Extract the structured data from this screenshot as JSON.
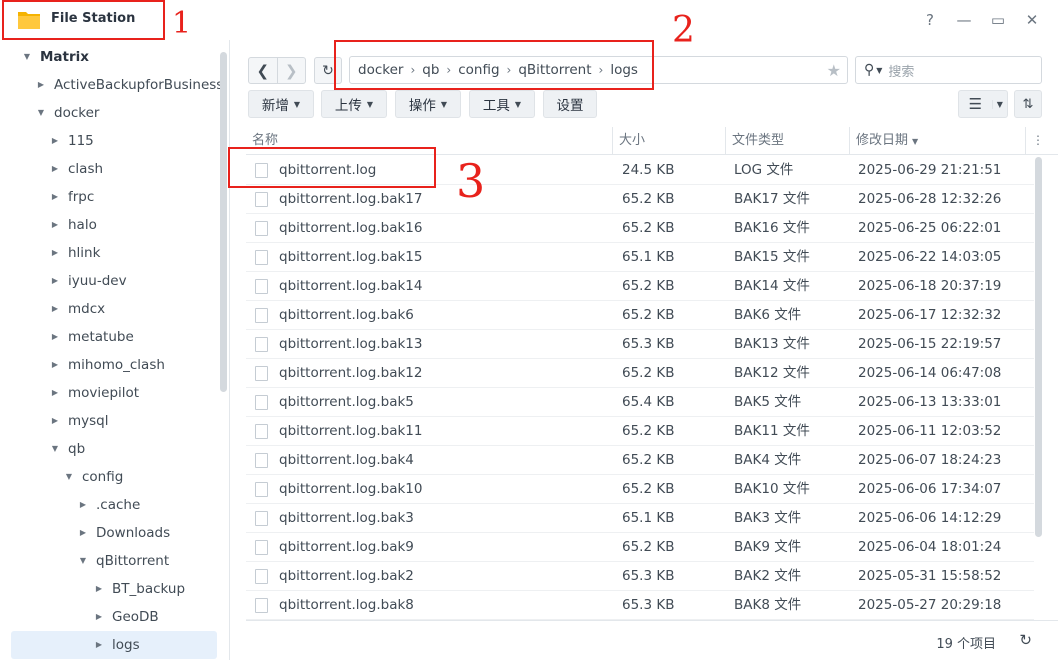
{
  "window": {
    "title": "File Station",
    "controls": {
      "help": "?",
      "minimize": "—",
      "maximize": "▭",
      "close": "✕"
    }
  },
  "sidebar": {
    "items": [
      {
        "label": "Matrix",
        "level": 0,
        "state": "expanded"
      },
      {
        "label": "ActiveBackupforBusiness",
        "level": 1,
        "state": "collapsed"
      },
      {
        "label": "docker",
        "level": 1,
        "state": "expanded"
      },
      {
        "label": "115",
        "level": 2,
        "state": "collapsed"
      },
      {
        "label": "clash",
        "level": 2,
        "state": "collapsed"
      },
      {
        "label": "frpc",
        "level": 2,
        "state": "collapsed"
      },
      {
        "label": "halo",
        "level": 2,
        "state": "collapsed"
      },
      {
        "label": "hlink",
        "level": 2,
        "state": "collapsed"
      },
      {
        "label": "iyuu-dev",
        "level": 2,
        "state": "collapsed"
      },
      {
        "label": "mdcx",
        "level": 2,
        "state": "collapsed"
      },
      {
        "label": "metatube",
        "level": 2,
        "state": "collapsed"
      },
      {
        "label": "mihomo_clash",
        "level": 2,
        "state": "collapsed"
      },
      {
        "label": "moviepilot",
        "level": 2,
        "state": "collapsed"
      },
      {
        "label": "mysql",
        "level": 2,
        "state": "collapsed"
      },
      {
        "label": "qb",
        "level": 2,
        "state": "expanded"
      },
      {
        "label": "config",
        "level": 3,
        "state": "expanded"
      },
      {
        "label": ".cache",
        "level": 4,
        "state": "collapsed"
      },
      {
        "label": "Downloads",
        "level": 4,
        "state": "collapsed"
      },
      {
        "label": "qBittorrent",
        "level": 4,
        "state": "expanded"
      },
      {
        "label": "BT_backup",
        "level": 5,
        "state": "collapsed"
      },
      {
        "label": "GeoDB",
        "level": 5,
        "state": "collapsed"
      },
      {
        "label": "logs",
        "level": 5,
        "state": "collapsed",
        "selected": true
      }
    ]
  },
  "toolbar": {
    "back_icon": "chevron-left-icon",
    "forward_icon": "chevron-right-icon",
    "refresh_icon": "refresh-icon",
    "breadcrumb": [
      "docker",
      "qb",
      "config",
      "qBittorrent",
      "logs"
    ],
    "search_placeholder": "搜索",
    "buttons": {
      "create": "新增",
      "upload": "上传",
      "action": "操作",
      "tools": "工具",
      "settings": "设置"
    }
  },
  "file_list": {
    "columns": {
      "name": "名称",
      "size": "大小",
      "type": "文件类型",
      "modified": "修改日期"
    },
    "rows": [
      {
        "name": "qbittorrent.log",
        "size": "24.5 KB",
        "type": "LOG 文件",
        "modified": "2025-06-29 21:21:51"
      },
      {
        "name": "qbittorrent.log.bak17",
        "size": "65.2 KB",
        "type": "BAK17 文件",
        "modified": "2025-06-28 12:32:26"
      },
      {
        "name": "qbittorrent.log.bak16",
        "size": "65.2 KB",
        "type": "BAK16 文件",
        "modified": "2025-06-25 06:22:01"
      },
      {
        "name": "qbittorrent.log.bak15",
        "size": "65.1 KB",
        "type": "BAK15 文件",
        "modified": "2025-06-22 14:03:05"
      },
      {
        "name": "qbittorrent.log.bak14",
        "size": "65.2 KB",
        "type": "BAK14 文件",
        "modified": "2025-06-18 20:37:19"
      },
      {
        "name": "qbittorrent.log.bak6",
        "size": "65.2 KB",
        "type": "BAK6 文件",
        "modified": "2025-06-17 12:32:32"
      },
      {
        "name": "qbittorrent.log.bak13",
        "size": "65.3 KB",
        "type": "BAK13 文件",
        "modified": "2025-06-15 22:19:57"
      },
      {
        "name": "qbittorrent.log.bak12",
        "size": "65.2 KB",
        "type": "BAK12 文件",
        "modified": "2025-06-14 06:47:08"
      },
      {
        "name": "qbittorrent.log.bak5",
        "size": "65.4 KB",
        "type": "BAK5 文件",
        "modified": "2025-06-13 13:33:01"
      },
      {
        "name": "qbittorrent.log.bak11",
        "size": "65.2 KB",
        "type": "BAK11 文件",
        "modified": "2025-06-11 12:03:52"
      },
      {
        "name": "qbittorrent.log.bak4",
        "size": "65.2 KB",
        "type": "BAK4 文件",
        "modified": "2025-06-07 18:24:23"
      },
      {
        "name": "qbittorrent.log.bak10",
        "size": "65.2 KB",
        "type": "BAK10 文件",
        "modified": "2025-06-06 17:34:07"
      },
      {
        "name": "qbittorrent.log.bak3",
        "size": "65.1 KB",
        "type": "BAK3 文件",
        "modified": "2025-06-06 14:12:29"
      },
      {
        "name": "qbittorrent.log.bak9",
        "size": "65.2 KB",
        "type": "BAK9 文件",
        "modified": "2025-06-04 18:01:24"
      },
      {
        "name": "qbittorrent.log.bak2",
        "size": "65.3 KB",
        "type": "BAK2 文件",
        "modified": "2025-05-31 15:58:52"
      },
      {
        "name": "qbittorrent.log.bak8",
        "size": "65.3 KB",
        "type": "BAK8 文件",
        "modified": "2025-05-27 20:29:18"
      }
    ]
  },
  "status": {
    "count": "19 个项目"
  },
  "annotations": {
    "one": "1",
    "two": "2",
    "three": "3",
    "color": "#e8221c"
  },
  "colors": {
    "accent": "#0086e5",
    "selected_bg": "#e6f0fb",
    "folder": "#f5b301"
  }
}
